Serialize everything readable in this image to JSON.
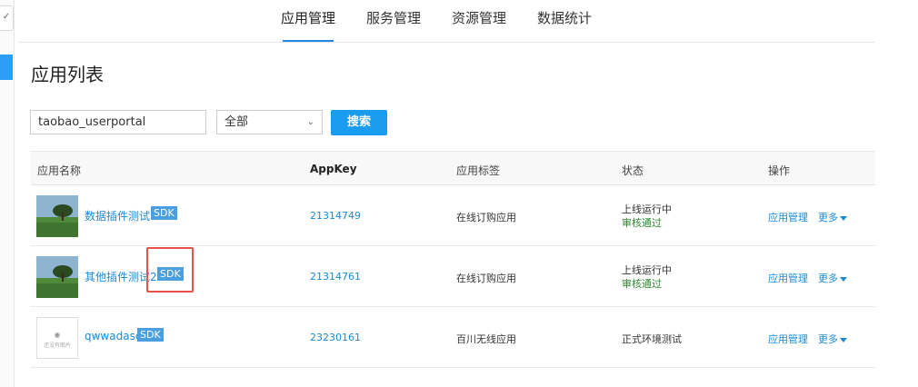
{
  "nav": {
    "tabs": [
      {
        "label": "应用管理",
        "active": true
      },
      {
        "label": "服务管理"
      },
      {
        "label": "资源管理"
      },
      {
        "label": "数据统计"
      }
    ]
  },
  "page": {
    "title": "应用列表"
  },
  "search": {
    "value": "taobao_userportal",
    "filter_selected": "全部",
    "button_label": "搜索"
  },
  "table": {
    "headers": [
      "应用名称",
      "AppKey",
      "应用标签",
      "状态",
      "操作"
    ],
    "rows": [
      {
        "name": "数据插件测试",
        "sdk": "SDK",
        "appkey": "21314749",
        "tag": "在线订购应用",
        "status": "上线运行中",
        "review": "审核通过",
        "thumb": "landscape",
        "op_manage": "应用管理",
        "op_more": "更多"
      },
      {
        "name": "其他插件测试2",
        "sdk": "SDK",
        "appkey": "21314761",
        "tag": "在线订购应用",
        "status": "上线运行中",
        "review": "审核通过",
        "thumb": "landscape",
        "op_manage": "应用管理",
        "op_more": "更多"
      },
      {
        "name": "qwwadasd",
        "sdk": "SDK",
        "appkey": "23230161",
        "tag": "百川无线应用",
        "status": "正式环境测试",
        "review": "",
        "thumb": "empty",
        "thumb_caption": "还没有图片",
        "op_manage": "应用管理",
        "op_more": "更多"
      }
    ]
  },
  "colors": {
    "accent": "#1a9cf0",
    "link": "#1a8bd6",
    "success": "#2e8b2e",
    "highlight_border": "#e5534b"
  }
}
